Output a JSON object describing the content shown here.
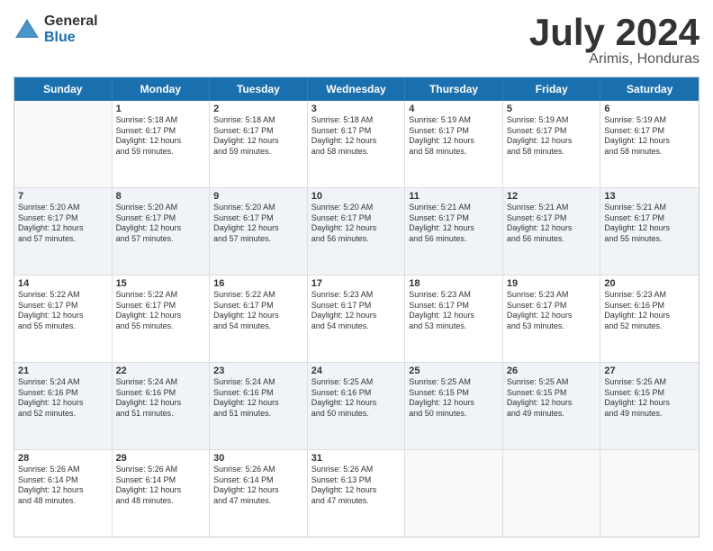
{
  "logo": {
    "general": "General",
    "blue": "Blue"
  },
  "title": {
    "month_year": "July 2024",
    "location": "Arimis, Honduras"
  },
  "weekdays": [
    "Sunday",
    "Monday",
    "Tuesday",
    "Wednesday",
    "Thursday",
    "Friday",
    "Saturday"
  ],
  "rows": [
    [
      {
        "day": "",
        "info": "",
        "shaded": true,
        "empty": true
      },
      {
        "day": "1",
        "info": "Sunrise: 5:18 AM\nSunset: 6:17 PM\nDaylight: 12 hours\nand 59 minutes.",
        "shaded": false
      },
      {
        "day": "2",
        "info": "Sunrise: 5:18 AM\nSunset: 6:17 PM\nDaylight: 12 hours\nand 59 minutes.",
        "shaded": false
      },
      {
        "day": "3",
        "info": "Sunrise: 5:18 AM\nSunset: 6:17 PM\nDaylight: 12 hours\nand 58 minutes.",
        "shaded": false
      },
      {
        "day": "4",
        "info": "Sunrise: 5:19 AM\nSunset: 6:17 PM\nDaylight: 12 hours\nand 58 minutes.",
        "shaded": false
      },
      {
        "day": "5",
        "info": "Sunrise: 5:19 AM\nSunset: 6:17 PM\nDaylight: 12 hours\nand 58 minutes.",
        "shaded": false
      },
      {
        "day": "6",
        "info": "Sunrise: 5:19 AM\nSunset: 6:17 PM\nDaylight: 12 hours\nand 58 minutes.",
        "shaded": false
      }
    ],
    [
      {
        "day": "7",
        "info": "Sunrise: 5:20 AM\nSunset: 6:17 PM\nDaylight: 12 hours\nand 57 minutes.",
        "shaded": true
      },
      {
        "day": "8",
        "info": "Sunrise: 5:20 AM\nSunset: 6:17 PM\nDaylight: 12 hours\nand 57 minutes.",
        "shaded": true
      },
      {
        "day": "9",
        "info": "Sunrise: 5:20 AM\nSunset: 6:17 PM\nDaylight: 12 hours\nand 57 minutes.",
        "shaded": true
      },
      {
        "day": "10",
        "info": "Sunrise: 5:20 AM\nSunset: 6:17 PM\nDaylight: 12 hours\nand 56 minutes.",
        "shaded": true
      },
      {
        "day": "11",
        "info": "Sunrise: 5:21 AM\nSunset: 6:17 PM\nDaylight: 12 hours\nand 56 minutes.",
        "shaded": true
      },
      {
        "day": "12",
        "info": "Sunrise: 5:21 AM\nSunset: 6:17 PM\nDaylight: 12 hours\nand 56 minutes.",
        "shaded": true
      },
      {
        "day": "13",
        "info": "Sunrise: 5:21 AM\nSunset: 6:17 PM\nDaylight: 12 hours\nand 55 minutes.",
        "shaded": true
      }
    ],
    [
      {
        "day": "14",
        "info": "Sunrise: 5:22 AM\nSunset: 6:17 PM\nDaylight: 12 hours\nand 55 minutes.",
        "shaded": false
      },
      {
        "day": "15",
        "info": "Sunrise: 5:22 AM\nSunset: 6:17 PM\nDaylight: 12 hours\nand 55 minutes.",
        "shaded": false
      },
      {
        "day": "16",
        "info": "Sunrise: 5:22 AM\nSunset: 6:17 PM\nDaylight: 12 hours\nand 54 minutes.",
        "shaded": false
      },
      {
        "day": "17",
        "info": "Sunrise: 5:23 AM\nSunset: 6:17 PM\nDaylight: 12 hours\nand 54 minutes.",
        "shaded": false
      },
      {
        "day": "18",
        "info": "Sunrise: 5:23 AM\nSunset: 6:17 PM\nDaylight: 12 hours\nand 53 minutes.",
        "shaded": false
      },
      {
        "day": "19",
        "info": "Sunrise: 5:23 AM\nSunset: 6:17 PM\nDaylight: 12 hours\nand 53 minutes.",
        "shaded": false
      },
      {
        "day": "20",
        "info": "Sunrise: 5:23 AM\nSunset: 6:16 PM\nDaylight: 12 hours\nand 52 minutes.",
        "shaded": false
      }
    ],
    [
      {
        "day": "21",
        "info": "Sunrise: 5:24 AM\nSunset: 6:16 PM\nDaylight: 12 hours\nand 52 minutes.",
        "shaded": true
      },
      {
        "day": "22",
        "info": "Sunrise: 5:24 AM\nSunset: 6:16 PM\nDaylight: 12 hours\nand 51 minutes.",
        "shaded": true
      },
      {
        "day": "23",
        "info": "Sunrise: 5:24 AM\nSunset: 6:16 PM\nDaylight: 12 hours\nand 51 minutes.",
        "shaded": true
      },
      {
        "day": "24",
        "info": "Sunrise: 5:25 AM\nSunset: 6:16 PM\nDaylight: 12 hours\nand 50 minutes.",
        "shaded": true
      },
      {
        "day": "25",
        "info": "Sunrise: 5:25 AM\nSunset: 6:15 PM\nDaylight: 12 hours\nand 50 minutes.",
        "shaded": true
      },
      {
        "day": "26",
        "info": "Sunrise: 5:25 AM\nSunset: 6:15 PM\nDaylight: 12 hours\nand 49 minutes.",
        "shaded": true
      },
      {
        "day": "27",
        "info": "Sunrise: 5:25 AM\nSunset: 6:15 PM\nDaylight: 12 hours\nand 49 minutes.",
        "shaded": true
      }
    ],
    [
      {
        "day": "28",
        "info": "Sunrise: 5:26 AM\nSunset: 6:14 PM\nDaylight: 12 hours\nand 48 minutes.",
        "shaded": false
      },
      {
        "day": "29",
        "info": "Sunrise: 5:26 AM\nSunset: 6:14 PM\nDaylight: 12 hours\nand 48 minutes.",
        "shaded": false
      },
      {
        "day": "30",
        "info": "Sunrise: 5:26 AM\nSunset: 6:14 PM\nDaylight: 12 hours\nand 47 minutes.",
        "shaded": false
      },
      {
        "day": "31",
        "info": "Sunrise: 5:26 AM\nSunset: 6:13 PM\nDaylight: 12 hours\nand 47 minutes.",
        "shaded": false
      },
      {
        "day": "",
        "info": "",
        "shaded": false,
        "empty": true
      },
      {
        "day": "",
        "info": "",
        "shaded": false,
        "empty": true
      },
      {
        "day": "",
        "info": "",
        "shaded": false,
        "empty": true
      }
    ]
  ]
}
